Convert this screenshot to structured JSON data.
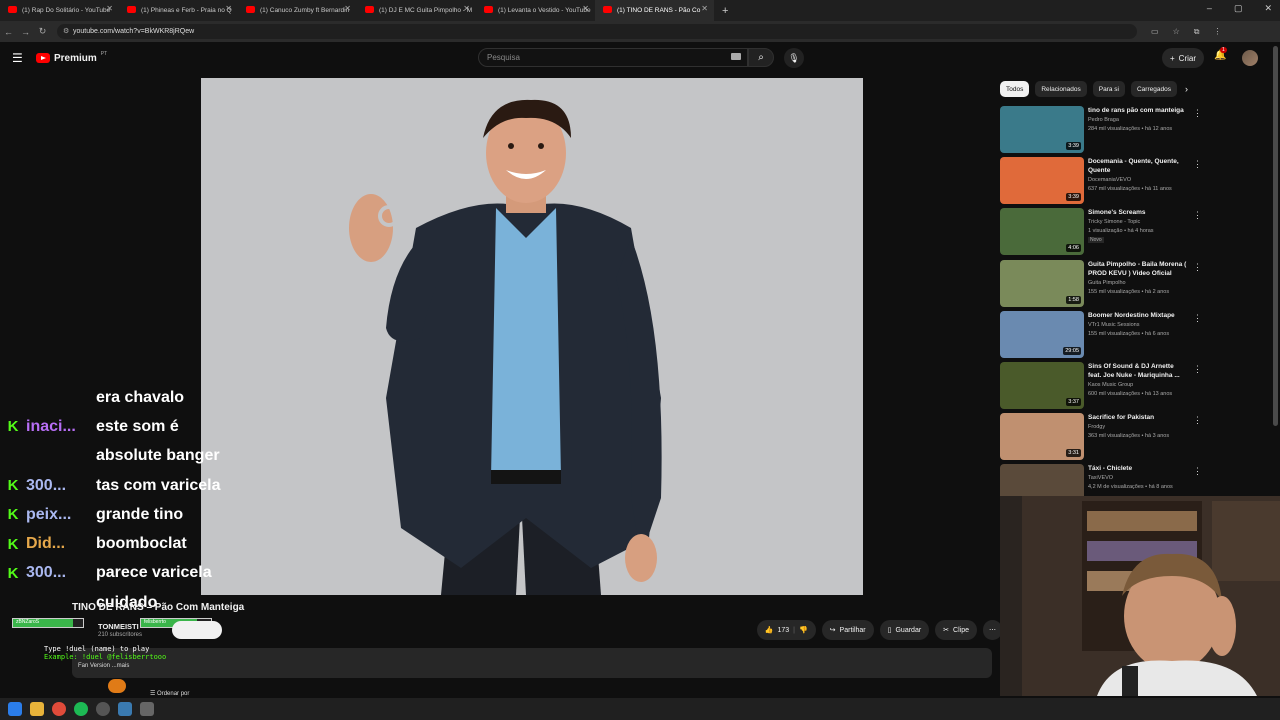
{
  "browser": {
    "tabs": [
      {
        "label": "(1) Rap Do Solitário - YouTube",
        "active": false
      },
      {
        "label": "(1) Phineas e Ferb - Praia no Q",
        "active": false
      },
      {
        "label": "(1) Canuco Zumby ft Bernardin",
        "active": false
      },
      {
        "label": "(1) DJ E MC Guita Pimpolho - M",
        "active": false
      },
      {
        "label": "(1) Levanta o Vestido - YouTube",
        "active": false
      },
      {
        "label": "(1) TINO DE RANS - Pão Co",
        "active": true
      }
    ],
    "url": "youtube.com/watch?v=BkWKR8jRQew"
  },
  "header": {
    "logo_text": "Premium",
    "country_code": "PT",
    "search_placeholder": "Pesquisa",
    "create_label": "Criar",
    "notification_count": "1"
  },
  "chat": {
    "messages": [
      {
        "user": "",
        "user_color": "#ffffff",
        "text": "era chavalo",
        "has_icon": false
      },
      {
        "user": "inaci...",
        "user_color": "#b76ef5",
        "text": "este som é",
        "has_icon": true
      },
      {
        "user": "",
        "user_color": "#ffffff",
        "text": "absolute banger",
        "has_icon": false
      },
      {
        "user": "300...",
        "user_color": "#aab8f0",
        "text": "tas com varicela",
        "has_icon": true
      },
      {
        "user": "peix...",
        "user_color": "#aab8f0",
        "text": "grande tino",
        "has_icon": true
      },
      {
        "user": "Did...",
        "user_color": "#e6a84b",
        "text": "boomboclat",
        "has_icon": true
      },
      {
        "user": "300...",
        "user_color": "#aab8f0",
        "text": "parece varicela",
        "has_icon": true
      },
      {
        "user": "",
        "user_color": "#ffffff",
        "text": "cuidado",
        "has_icon": false
      }
    ]
  },
  "video": {
    "title": "TINO DE RANS – Pão Com Manteiga",
    "channel_name": "TONMEISTI",
    "subscribers": "210 subscritores",
    "likes": "173",
    "share_label": "Partilhar",
    "save_label": "Guardar",
    "clip_label": "Clipe",
    "desc_text": "Fan Version ...mais",
    "sort_label": "Ordenar por",
    "overlay_hp_left": "zBNZaroS",
    "overlay_hp_right": "felisberrto",
    "overlay_hp_left_level": 0.85,
    "overlay_hp_right_level": 0.8,
    "duel_line1": "Type !duel (name) to play",
    "duel_line2": "Example: !duel @felisberrtooo"
  },
  "sidebar": {
    "chips": [
      "Todos",
      "Relacionados",
      "Para si",
      "Carregados"
    ],
    "recommendations": [
      {
        "title": "tino de rans pão com manteiga",
        "channel": "Pedro Braga",
        "meta": "284 mil visualizações • há 12 anos",
        "duration": "3:39",
        "badge": "",
        "thumb": "#3a7a8a"
      },
      {
        "title": "Docemania - Quente, Quente, Quente",
        "channel": "DocemaniaVEVO",
        "meta": "637 mil visualizações • há 11 anos",
        "duration": "3:39",
        "badge": "",
        "thumb": "#e06a3a"
      },
      {
        "title": "Simone's Screams",
        "channel": "Tricky Simone - Topic",
        "meta": "1 visualização • há 4 horas",
        "duration": "4:06",
        "badge": "Novo",
        "thumb": "#4a6a3a"
      },
      {
        "title": "Guita Pimpolho - Baila Morena ( PROD KEVU ) Video Oficial",
        "channel": "Guita Pimpolho",
        "meta": "155 mil visualizações • há 2 anos",
        "duration": "1:58",
        "badge": "",
        "thumb": "#7a8a5a"
      },
      {
        "title": "Boomer Nordestino Mixtape",
        "channel": "VTr1 Music Sessions",
        "meta": "155 mil visualizações • há 6 anos",
        "duration": "29:05",
        "badge": "",
        "thumb": "#6a8ab0"
      },
      {
        "title": "Sins Of Sound & DJ Arnette feat. Joe Nuke - Mariquinha ...",
        "channel": "Kaos Music Group",
        "meta": "600 mil visualizações • há 13 anos",
        "duration": "3:37",
        "badge": "",
        "thumb": "#4a5a2a"
      },
      {
        "title": "Sacrifice for Pakistan",
        "channel": "Frodgy",
        "meta": "363 mil visualizações • há 3 anos",
        "duration": "3:31",
        "badge": "",
        "thumb": "#c09070"
      },
      {
        "title": "Táxi - Chiclete",
        "channel": "TaxiVEVO",
        "meta": "4,2 M de visualizações • há 8 anos",
        "duration": "",
        "badge": "",
        "thumb": "#5a4a3a"
      }
    ]
  }
}
